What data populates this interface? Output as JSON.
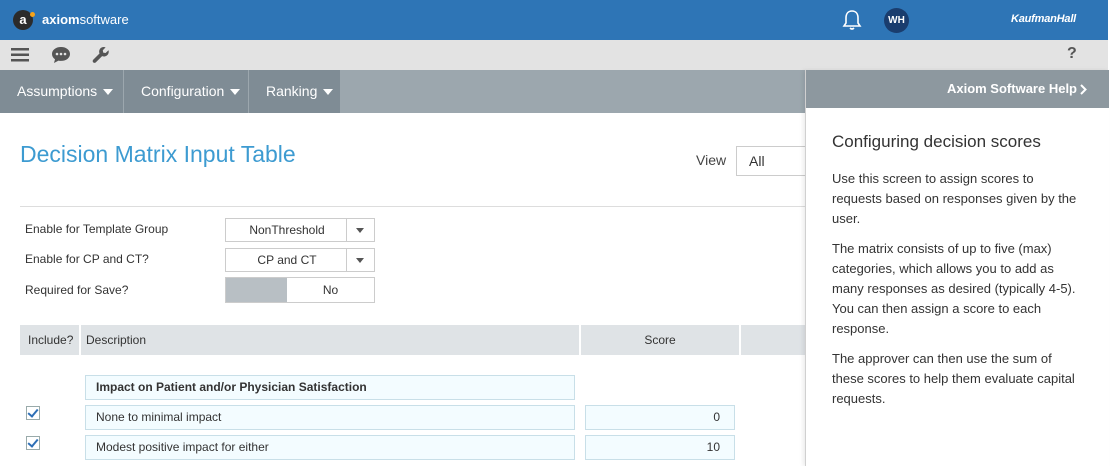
{
  "brand": {
    "name_bold": "axiom",
    "name_rest": "software",
    "logo_letter": "a"
  },
  "header": {
    "user_initials": "WH",
    "company": "KaufmanHall"
  },
  "toolbar": {
    "help": "?"
  },
  "nav": [
    {
      "label": "Assumptions"
    },
    {
      "label": "Configuration"
    },
    {
      "label": "Ranking"
    }
  ],
  "page": {
    "title": "Decision Matrix Input Table",
    "view_label": "View",
    "view_value": "All"
  },
  "form": {
    "template_group_label": "Enable for Template Group",
    "template_group_value": "NonThreshold",
    "cp_ct_label": "Enable for CP and CT?",
    "cp_ct_value": "CP and CT",
    "required_label": "Required for Save?",
    "required_value": "No"
  },
  "table": {
    "headers": [
      "Include?",
      "Description",
      "Score"
    ],
    "section": "Impact on Patient and/or Physician Satisfaction",
    "rows": [
      {
        "description": "None to minimal impact",
        "score": "0",
        "include": true
      },
      {
        "description": "Modest positive impact for either",
        "score": "10",
        "include": true
      }
    ]
  },
  "help": {
    "header": "Axiom Software Help",
    "title": "Configuring decision scores",
    "paragraphs": [
      "Use this screen to assign scores to requests based on responses given by the user.",
      "The matrix consists of up to five (max) categories, which allows you to add as many responses as desired (typically 4-5). You can then assign a score to each response.",
      "The approver can then use the sum of these scores to help them evaluate capital requests."
    ]
  },
  "colors": {
    "topbar": "#2e75b6",
    "title": "#3d9bd1",
    "nav": "#7f8c95"
  }
}
